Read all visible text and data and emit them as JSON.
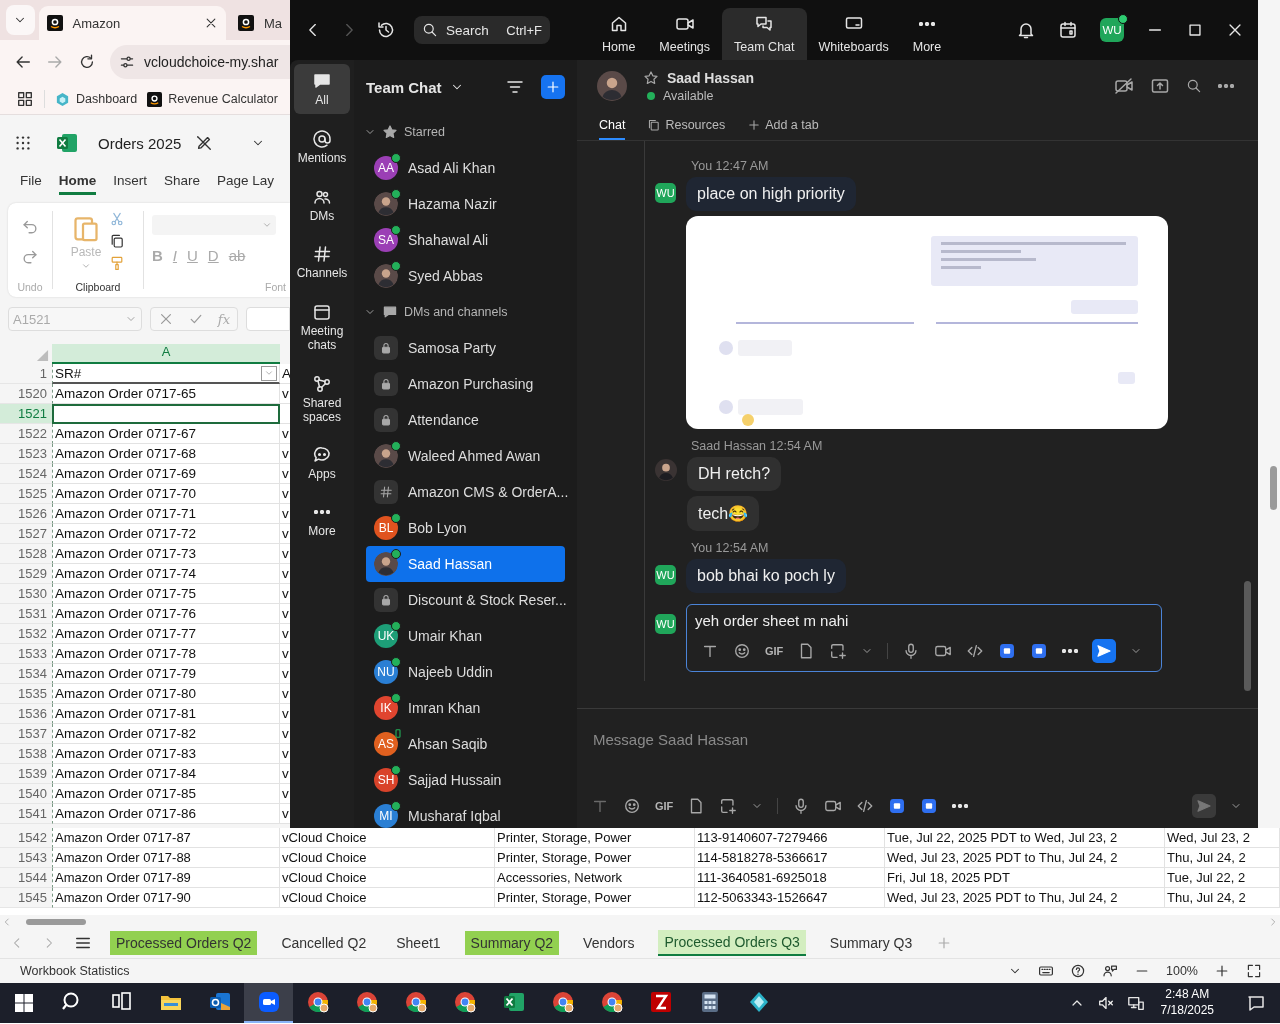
{
  "browser": {
    "tabs": [
      {
        "title": "Amazon",
        "selected": true
      },
      {
        "title": "Ma",
        "selected": false
      }
    ],
    "address": "vcloudchoice-my.shar",
    "bookmarks": [
      "Dashboard",
      "Revenue Calculator"
    ]
  },
  "excel": {
    "file_name": "Orders 2025",
    "ribbon_tabs": [
      {
        "label": "File",
        "selected": false
      },
      {
        "label": "Home",
        "selected": true
      },
      {
        "label": "Insert",
        "selected": false
      },
      {
        "label": "Share",
        "selected": false
      },
      {
        "label": "Page Lay",
        "selected": false
      }
    ],
    "paste_label": "Paste",
    "group_labels": [
      "Undo",
      "Clipboard",
      "Font"
    ],
    "font_buttons": [
      "B",
      "I",
      "U",
      "D",
      "ab"
    ],
    "name_box": "A1521",
    "formula_label": "fx",
    "column_headers": [
      {
        "label": "A",
        "selected": true
      }
    ],
    "header_row": {
      "num": "1",
      "cells": [
        "SR#",
        "A"
      ]
    },
    "rows": [
      {
        "num": "1520",
        "selected": false,
        "cells": [
          "Amazon Order 0717-65",
          "v"
        ]
      },
      {
        "num": "1521",
        "selected": true,
        "cells": []
      },
      {
        "num": "1522",
        "selected": false,
        "cells": [
          "Amazon Order 0717-67",
          "v"
        ]
      },
      {
        "num": "1523",
        "selected": false,
        "cells": [
          "Amazon Order 0717-68",
          "v"
        ]
      },
      {
        "num": "1524",
        "selected": false,
        "cells": [
          "Amazon Order 0717-69",
          "v"
        ]
      },
      {
        "num": "1525",
        "selected": false,
        "cells": [
          "Amazon Order 0717-70",
          "v"
        ]
      },
      {
        "num": "1526",
        "selected": false,
        "cells": [
          "Amazon Order 0717-71",
          "v"
        ]
      },
      {
        "num": "1527",
        "selected": false,
        "cells": [
          "Amazon Order 0717-72",
          "v"
        ]
      },
      {
        "num": "1528",
        "selected": false,
        "cells": [
          "Amazon Order 0717-73",
          "v"
        ]
      },
      {
        "num": "1529",
        "selected": false,
        "cells": [
          "Amazon Order 0717-74",
          "v"
        ]
      },
      {
        "num": "1530",
        "selected": false,
        "cells": [
          "Amazon Order 0717-75",
          "v"
        ]
      },
      {
        "num": "1531",
        "selected": false,
        "cells": [
          "Amazon Order 0717-76",
          "v"
        ]
      },
      {
        "num": "1532",
        "selected": false,
        "cells": [
          "Amazon Order 0717-77",
          "v"
        ]
      },
      {
        "num": "1533",
        "selected": false,
        "cells": [
          "Amazon Order 0717-78",
          "v"
        ]
      },
      {
        "num": "1534",
        "selected": false,
        "cells": [
          "Amazon Order 0717-79",
          "v"
        ]
      },
      {
        "num": "1535",
        "selected": false,
        "cells": [
          "Amazon Order 0717-80",
          "v"
        ]
      },
      {
        "num": "1536",
        "selected": false,
        "cells": [
          "Amazon Order 0717-81",
          "v"
        ]
      },
      {
        "num": "1537",
        "selected": false,
        "cells": [
          "Amazon Order 0717-82",
          "v"
        ]
      },
      {
        "num": "1538",
        "selected": false,
        "cells": [
          "Amazon Order 0717-83",
          "v"
        ]
      },
      {
        "num": "1539",
        "selected": false,
        "cells": [
          "Amazon Order 0717-84",
          "v"
        ]
      },
      {
        "num": "1540",
        "selected": false,
        "cells": [
          "Amazon Order 0717-85",
          "v"
        ]
      },
      {
        "num": "1541",
        "selected": false,
        "cells": [
          "Amazon Order 0717-86",
          "v"
        ]
      },
      {
        "num": "1542",
        "selected": false,
        "cells": [
          "Amazon Order 0717-87",
          "vCloud Choice",
          "Printer, Storage, Power",
          "113-9140607-7279466",
          "Tue, Jul 22, 2025 PDT to Wed, Jul 23, 2",
          "Wed, Jul 23, 2"
        ]
      },
      {
        "num": "1543",
        "selected": false,
        "cells": [
          "Amazon Order 0717-88",
          "vCloud Choice",
          "Printer, Storage, Power",
          "114-5818278-5366617",
          "Wed, Jul 23, 2025 PDT to Thu, Jul 24, 2",
          "Thu, Jul 24, 2"
        ]
      },
      {
        "num": "1544",
        "selected": false,
        "cells": [
          "Amazon Order 0717-89",
          "vCloud Choice",
          "Accessories, Network",
          "111-3640581-6925018",
          "Fri, Jul 18, 2025 PDT",
          "Tue, Jul 22, 2"
        ]
      },
      {
        "num": "1545",
        "selected": false,
        "cells": [
          "Amazon Order 0717-90",
          "vCloud Choice",
          "Printer, Storage, Power",
          "112-5063343-1526647",
          "Wed, Jul 23, 2025 PDT to Thu, Jul 24, 2",
          "Thu, Jul 24, 2"
        ]
      }
    ],
    "sheet_tabs": [
      {
        "label": "Processed Orders Q2",
        "selected": false,
        "color": "#92d050"
      },
      {
        "label": "Cancelled Q2",
        "selected": false
      },
      {
        "label": "Sheet1",
        "selected": false
      },
      {
        "label": "Summary Q2",
        "selected": false,
        "color": "#92d050"
      },
      {
        "label": "Vendors",
        "selected": false
      },
      {
        "label": "Processed Orders Q3",
        "selected": true,
        "color": "#d3eec0"
      },
      {
        "label": "Summary Q3",
        "selected": false
      }
    ],
    "status": "Workbook Statistics",
    "zoom": "100%"
  },
  "zoom": {
    "search": {
      "placeholder": "Search",
      "shortcut": "Ctrl+F"
    },
    "nav": [
      {
        "kind": "home",
        "label": "Home",
        "selected": false
      },
      {
        "kind": "meetings",
        "label": "Meetings",
        "selected": false
      },
      {
        "kind": "chat",
        "label": "Team Chat",
        "selected": true
      },
      {
        "kind": "whiteboards",
        "label": "Whiteboards",
        "selected": false
      },
      {
        "kind": "more",
        "label": "More",
        "selected": false
      }
    ],
    "user_initials": "WU",
    "rail": [
      {
        "kind": "all",
        "label": "All",
        "selected": true
      },
      {
        "kind": "mentions",
        "label": "Mentions",
        "selected": false
      },
      {
        "kind": "dms",
        "label": "DMs",
        "selected": false
      },
      {
        "kind": "channels",
        "label": "Channels",
        "selected": false
      },
      {
        "kind": "meeting",
        "label": "Meeting chats",
        "selected": false
      },
      {
        "kind": "spaces",
        "label": "Shared spaces",
        "selected": false
      },
      {
        "kind": "apps",
        "label": "Apps",
        "selected": false
      },
      {
        "kind": "more",
        "label": "More",
        "selected": false
      }
    ],
    "list_title": "Team Chat",
    "sections": [
      {
        "title": "Starred",
        "kind": "starred",
        "expanded": true,
        "items": [
          {
            "name": "Asad Ali Khan",
            "kind": "initials",
            "initials": "AA",
            "color": "#9b3fb5",
            "online": true,
            "mobile": false,
            "selected": false
          },
          {
            "name": "Hazama Nazir",
            "kind": "photo",
            "online": true,
            "mobile": false,
            "selected": false
          },
          {
            "name": "Shahawal Ali",
            "kind": "initials",
            "initials": "SA",
            "color": "#9b3fb5",
            "online": true,
            "mobile": false,
            "selected": false
          },
          {
            "name": "Syed Abbas",
            "kind": "photo",
            "online": true,
            "mobile": false,
            "selected": false
          }
        ]
      },
      {
        "title": "DMs and channels",
        "kind": "chats",
        "expanded": true,
        "items": [
          {
            "name": "Samosa Party",
            "kind": "lock",
            "online": false,
            "mobile": false,
            "selected": false
          },
          {
            "name": "Amazon Purchasing",
            "kind": "lock",
            "online": false,
            "mobile": false,
            "selected": false
          },
          {
            "name": "Attendance",
            "kind": "lock",
            "online": false,
            "mobile": false,
            "selected": false
          },
          {
            "name": "Waleed Ahmed Awan",
            "kind": "photo",
            "online": true,
            "mobile": false,
            "selected": false
          },
          {
            "name": "Amazon CMS & OrderA...",
            "kind": "hash",
            "online": false,
            "mobile": false,
            "selected": false
          },
          {
            "name": "Bob Lyon",
            "kind": "initials",
            "initials": "BL",
            "color": "#e0531f",
            "online": true,
            "mobile": false,
            "selected": false
          },
          {
            "name": "Saad Hassan",
            "kind": "photo",
            "online": true,
            "mobile": false,
            "selected": true
          },
          {
            "name": "Discount & Stock Reser...",
            "kind": "lock",
            "online": false,
            "mobile": false,
            "selected": false
          },
          {
            "name": "Umair Khan",
            "kind": "initials",
            "initials": "UK",
            "color": "#1d9e77",
            "online": true,
            "mobile": false,
            "selected": false
          },
          {
            "name": "Najeeb Uddin",
            "kind": "initials",
            "initials": "NU",
            "color": "#2a7fd4",
            "online": true,
            "mobile": false,
            "selected": false
          },
          {
            "name": "Imran Khan",
            "kind": "initials",
            "initials": "IK",
            "color": "#e0452f",
            "online": true,
            "mobile": false,
            "selected": false
          },
          {
            "name": "Ahsan Saqib",
            "kind": "initials",
            "initials": "AS",
            "color": "#e0601f",
            "online": false,
            "mobile": true,
            "selected": false
          },
          {
            "name": "Sajjad Hussain",
            "kind": "initials",
            "initials": "SH",
            "color": "#d9432a",
            "online": true,
            "mobile": false,
            "selected": false
          },
          {
            "name": "Musharaf Iqbal",
            "kind": "initials",
            "initials": "MI",
            "color": "#2a7fd4",
            "online": true,
            "mobile": false,
            "selected": false
          }
        ]
      }
    ],
    "chat": {
      "name": "Saad Hassan",
      "status": "Available",
      "tabs": [
        {
          "kind": "chat",
          "label": "Chat",
          "selected": true
        },
        {
          "kind": "resources",
          "label": "Resources",
          "selected": false
        },
        {
          "kind": "add",
          "label": "Add a tab",
          "selected": false
        }
      ],
      "messages": [
        {
          "sender": "You",
          "time": "12:47 AM",
          "mine": true,
          "initials": "WU",
          "bubbles": [
            "place on high priority"
          ],
          "screenshot": true
        },
        {
          "sender": "Saad Hassan",
          "time": "12:54 AM",
          "mine": false,
          "bubbles": [
            "DH retch?",
            "tech😂"
          ],
          "screenshot": false
        },
        {
          "sender": "You",
          "time": "12:54 AM",
          "mine": true,
          "initials": "WU",
          "bubbles": [
            "bob bhai ko poch ly"
          ],
          "screenshot": false
        }
      ],
      "draft": {
        "initials": "WU",
        "value": "yeh order sheet m nahi",
        "gif": "GIF"
      },
      "composer": {
        "placeholder": "Message Saad Hassan",
        "gif": "GIF"
      }
    }
  },
  "taskbar": {
    "apps": [
      {
        "kind": "search",
        "selected": false
      },
      {
        "kind": "taskview",
        "selected": false
      },
      {
        "kind": "explorer",
        "selected": false
      },
      {
        "kind": "outlook",
        "selected": false
      },
      {
        "kind": "zoom",
        "selected": true
      },
      {
        "kind": "chrome",
        "selected": false
      },
      {
        "kind": "chrome",
        "selected": false
      },
      {
        "kind": "chrome",
        "selected": false
      },
      {
        "kind": "chrome",
        "selected": false
      },
      {
        "kind": "excel",
        "selected": false
      },
      {
        "kind": "chrome",
        "selected": false
      },
      {
        "kind": "chrome",
        "selected": false
      },
      {
        "kind": "filezilla",
        "selected": false
      },
      {
        "kind": "calculator",
        "selected": false
      },
      {
        "kind": "diamond",
        "selected": false
      }
    ],
    "time": "2:48 AM",
    "date": "7/18/2025"
  }
}
